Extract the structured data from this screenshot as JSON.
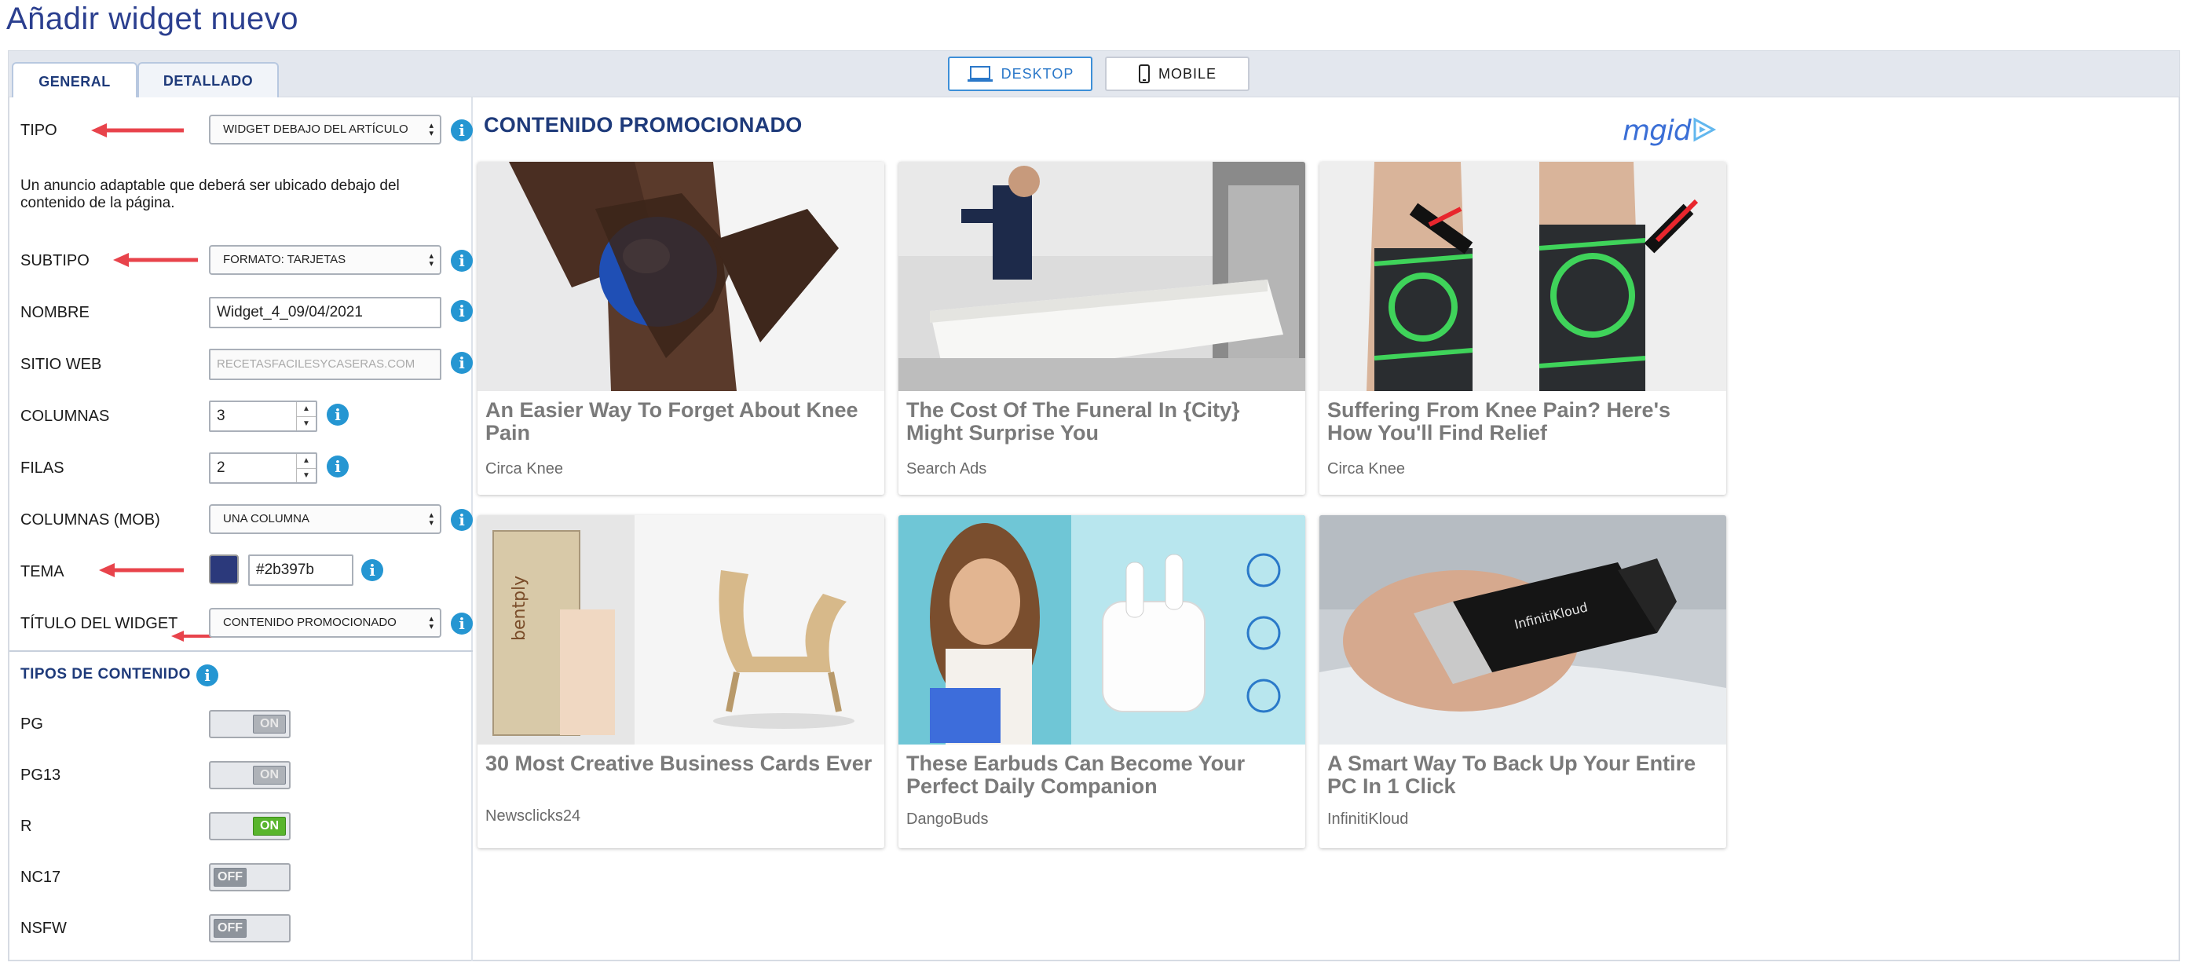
{
  "page": {
    "title": "Añadir widget nuevo"
  },
  "tabs": [
    {
      "label": "GENERAL",
      "active": true
    },
    {
      "label": "DETALLADO",
      "active": false
    }
  ],
  "device": {
    "desktop_label": "DESKTOP",
    "mobile_label": "MOBILE",
    "selected": "DESKTOP"
  },
  "form": {
    "tipo": {
      "label": "TIPO",
      "value": "WIDGET DEBAJO DEL ARTÍCULO"
    },
    "description": "Un anuncio adaptable que deberá ser ubicado debajo del contenido de la página.",
    "subtipo": {
      "label": "SUBTIPO",
      "value": "FORMATO: TARJETAS"
    },
    "nombre": {
      "label": "NOMBRE",
      "value": "Widget_4_09/04/2021"
    },
    "sitio_web": {
      "label": "SITIO WEB",
      "value": "RECETASFACILESYCASERAS.COM"
    },
    "columnas": {
      "label": "COLUMNAS",
      "value": "3"
    },
    "filas": {
      "label": "FILAS",
      "value": "2"
    },
    "columnas_mob": {
      "label": "COLUMNAS (MOB)",
      "value": "UNA COLUMNA"
    },
    "tema": {
      "label": "TEMA",
      "value": "#2b397b",
      "swatch_color": "#2b397b"
    },
    "titulo_widget": {
      "label": "TÍTULO DEL WIDGET",
      "value": "CONTENIDO PROMOCIONADO"
    }
  },
  "content_types": {
    "title": "TIPOS DE CONTENIDO",
    "items": [
      {
        "label": "PG",
        "state": "ON",
        "style": "on-disabled"
      },
      {
        "label": "PG13",
        "state": "ON",
        "style": "on-disabled"
      },
      {
        "label": "R",
        "state": "ON",
        "style": "on-active"
      },
      {
        "label": "NC17",
        "state": "OFF",
        "style": "off"
      },
      {
        "label": "NSFW",
        "state": "OFF",
        "style": "off"
      }
    ]
  },
  "preview": {
    "title": "CONTENIDO PROMOCIONADO",
    "brand": "mgid",
    "cards": [
      {
        "headline": "An Easier Way To Forget About Knee Pain",
        "source": "Circa Knee",
        "image": "knee-ice-pack"
      },
      {
        "headline": "The Cost Of The Funeral In {City} Might Surprise You",
        "source": "Search Ads",
        "image": "white-casket"
      },
      {
        "headline": "Suffering From Knee Pain? Here's How You'll Find Relief",
        "source": "Circa Knee",
        "image": "knee-braces"
      },
      {
        "headline": "30 Most Creative Business Cards Ever",
        "source": "Newsclicks24",
        "image": "cardboard-chair-card"
      },
      {
        "headline": "These Earbuds Can Become Your Perfect Daily Companion",
        "source": "DangoBuds",
        "image": "earbuds-woman"
      },
      {
        "headline": "A Smart Way To Back Up Your Entire PC In 1 Click",
        "source": "InfinitiKloud",
        "image": "usb-drive"
      }
    ]
  },
  "colors": {
    "accent": "#2b3f8f",
    "info": "#2596d2",
    "arrow": "#e8434b",
    "toggle_on": "#59b52d"
  }
}
